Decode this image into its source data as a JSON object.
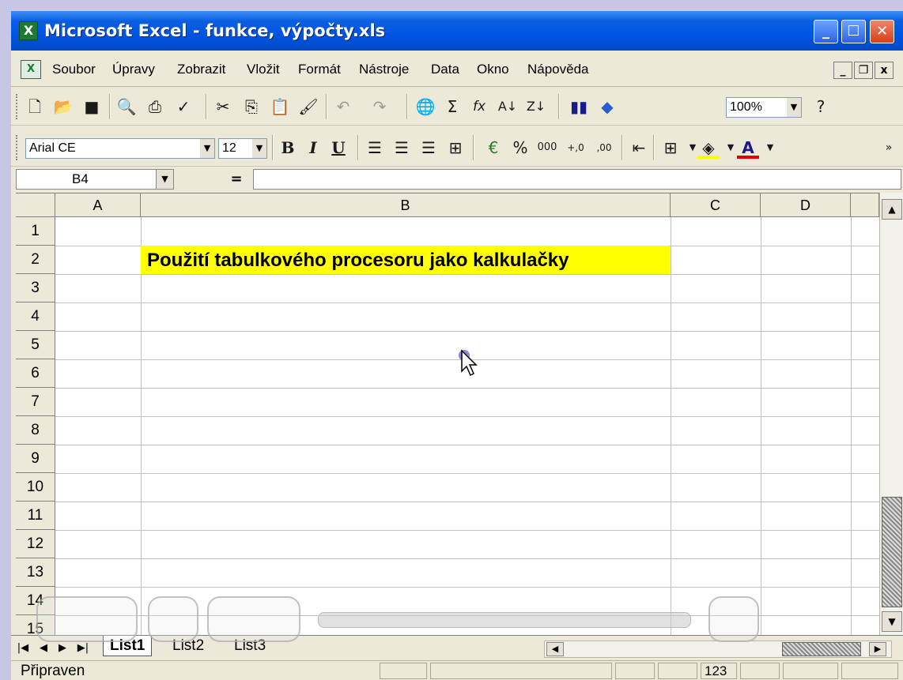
{
  "window": {
    "title": "Microsoft Excel - funkce, výpočty.xls",
    "app_icon": "excel-icon",
    "minimize": "_",
    "maximize": "☐",
    "close": "✕"
  },
  "menu": {
    "items": [
      "Soubor",
      "Úpravy",
      "Zobrazit",
      "Vložit",
      "Formát",
      "Nástroje",
      "Data",
      "Okno",
      "Nápověda"
    ],
    "doc_minimize": "_",
    "doc_restore": "❐",
    "doc_close": "x"
  },
  "standard_toolbar": {
    "icons": [
      "new-icon",
      "open-icon",
      "save-icon",
      "print-preview-icon",
      "print-icon",
      "spelling-icon",
      "cut-icon",
      "copy-icon",
      "paste-icon",
      "format-painter-icon",
      "undo-icon",
      "redo-icon",
      "hyperlink-icon",
      "autosum-icon",
      "function-icon",
      "sort-ascending-icon",
      "sort-descending-icon",
      "chart-wizard-icon",
      "drawing-icon",
      "help-icon"
    ],
    "autosum_glyph": "Σ",
    "function_glyph": "fx",
    "zoom": "100%"
  },
  "formatting_toolbar": {
    "font": "Arial CE",
    "size": "12",
    "bold": "B",
    "italic": "I",
    "underline": "U",
    "percent": "%",
    "thousands": "000",
    "increase_decimal": "+,0",
    "decrease_decimal": ",00",
    "font_color_glyph": "A",
    "more": "»"
  },
  "formula_bar": {
    "name_box": "B4",
    "equals": "=",
    "formula": ""
  },
  "sheet": {
    "columns": [
      "A",
      "B",
      "C",
      "D"
    ],
    "rows": [
      "1",
      "2",
      "3",
      "4",
      "5",
      "6",
      "7",
      "8",
      "9",
      "10",
      "11",
      "12",
      "13",
      "14",
      "15"
    ],
    "cell_b2": "Použití tabulkového procesoru jako kalkulačky",
    "cell_b2_fill": "#ffff00"
  },
  "sheet_tabs": {
    "tabs": [
      "List1",
      "List2",
      "List3"
    ],
    "active": "List1"
  },
  "status": {
    "text": "Připraven",
    "indicator": "123"
  },
  "colors": {
    "titlebar": "#0054e3",
    "chrome": "#ece9d8",
    "highlight": "#ffff00"
  }
}
